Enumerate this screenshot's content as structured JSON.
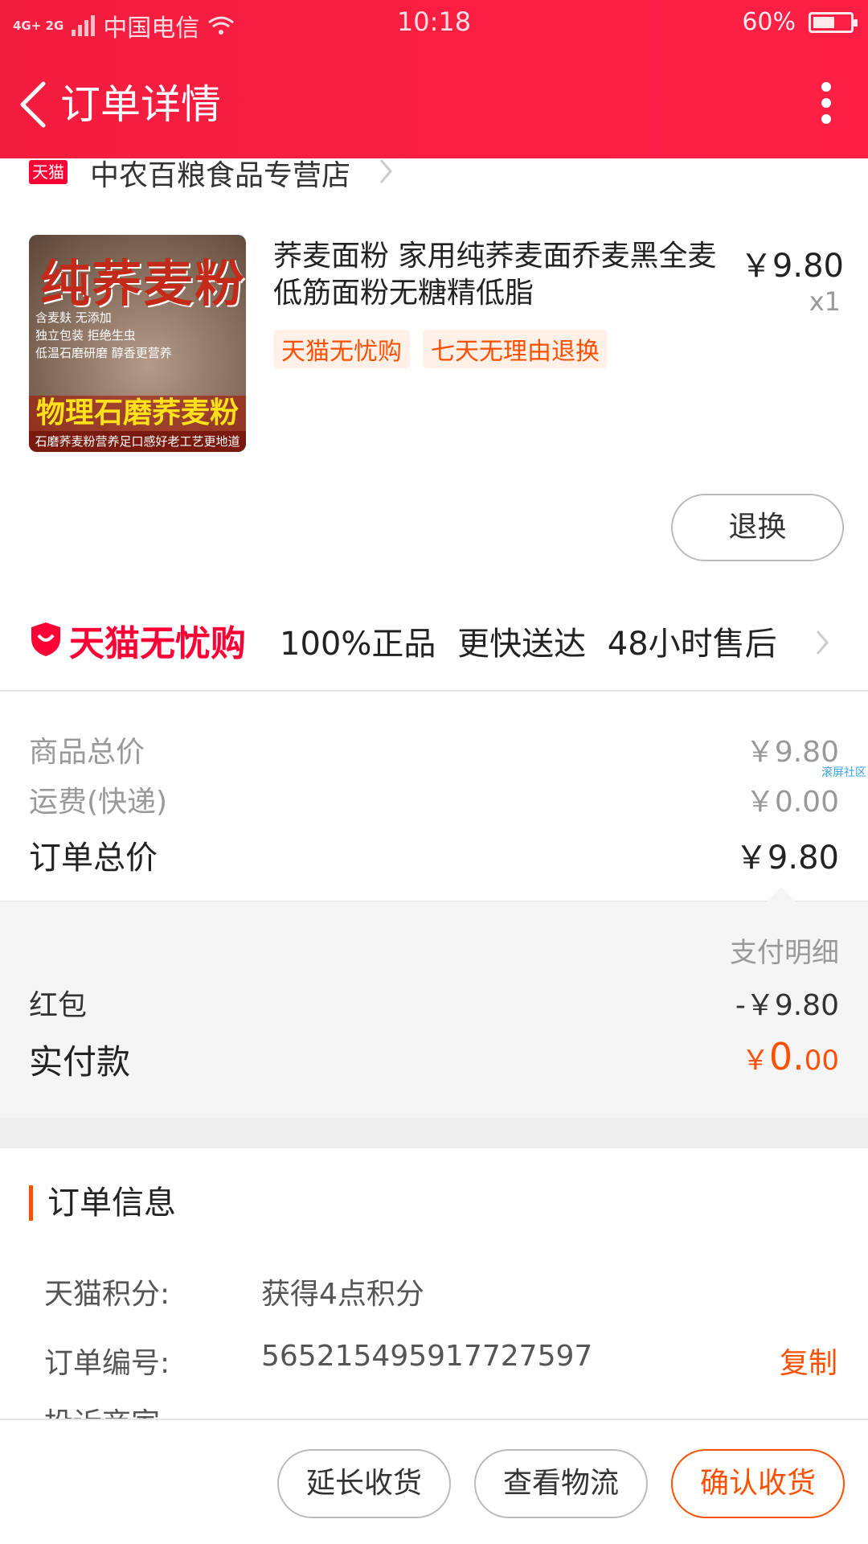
{
  "status_bar": {
    "network": "4G+ 2G",
    "carrier": "中国电信",
    "time": "10:18",
    "battery_percent": "60%",
    "battery_level": 0.6
  },
  "nav": {
    "title": "订单详情"
  },
  "store": {
    "badge": "天猫",
    "name": "中农百粮食品专营店"
  },
  "product": {
    "image_text": {
      "headline": "纯荞麦粉",
      "lines": [
        "含麦麸 无添加",
        "独立包装 拒绝生虫",
        "低温石磨研磨 醇香更营养"
      ],
      "banner": "物理石磨荞麦粉",
      "footer": "石磨荞麦粉营养足口感好老工艺更地道"
    },
    "title": "荞麦面粉 家用纯荞麦面乔麦黑全麦低筋面粉无糖精低脂",
    "price": "￥9.80",
    "qty": "x1",
    "tags": [
      "天猫无忧购",
      "七天无理由退换"
    ],
    "exchange_label": "退换"
  },
  "assurance": {
    "brand": "天猫无忧购",
    "text": "100%正品  更快送达  48小时售后"
  },
  "summary": {
    "goods_label": "商品总价",
    "goods_value": "￥9.80",
    "shipping_label": "运费(快递)",
    "shipping_value": "￥0.00",
    "total_label": "订单总价",
    "total_value": "￥9.80",
    "watermark": "滚屏社区"
  },
  "payment": {
    "detail_title": "支付明细",
    "redpack_label": "红包",
    "redpack_value": "-￥9.80",
    "actual_label": "实付款",
    "actual_symbol": "￥",
    "actual_int": "0.",
    "actual_dec": "00"
  },
  "order_info": {
    "title": "订单信息",
    "points_label": "天猫积分:",
    "points_value": "获得4点积分",
    "order_no_label": "订单编号:",
    "order_no_value": "565215495917727597",
    "copy_label": "复制",
    "partial_label": "投诉商家"
  },
  "bottom": {
    "extend_label": "延长收货",
    "logistics_label": "查看物流",
    "confirm_label": "确认收货"
  },
  "colors": {
    "header_red": "#f31d3f",
    "tmall_red": "#ff0036",
    "accent_orange": "#ff5000"
  }
}
